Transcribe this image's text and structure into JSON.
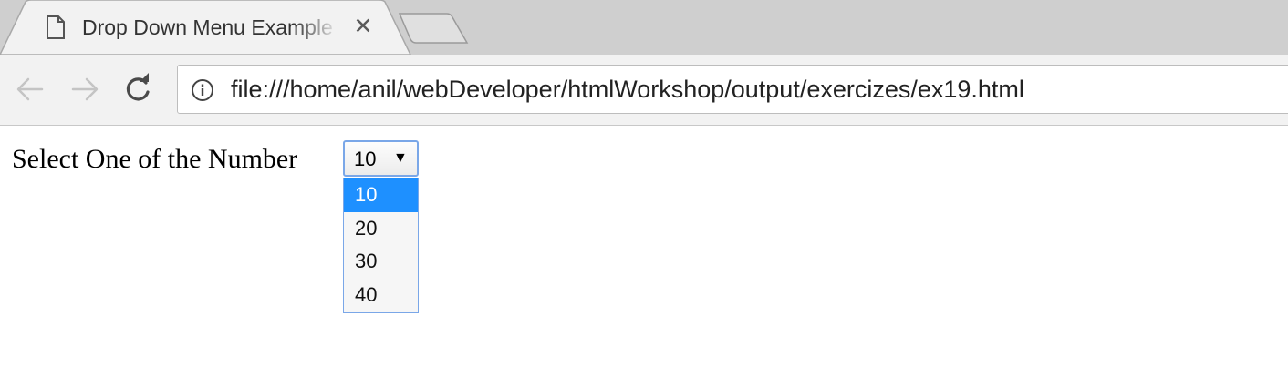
{
  "browser": {
    "tab": {
      "title": "Drop Down Menu Example",
      "icon": "document-icon",
      "close_glyph": "✕"
    },
    "new_tab_icon": "new-tab-icon",
    "toolbar": {
      "back_icon": "back-arrow-icon",
      "forward_icon": "forward-arrow-icon",
      "reload_icon": "reload-icon",
      "info_icon": "info-icon",
      "url": "file:///home/anil/webDeveloper/htmlWorkshop/output/exercizes/ex19.html"
    }
  },
  "page": {
    "label": "Select One of the Number",
    "select": {
      "value": "10",
      "arrow": "▼",
      "options": [
        "10",
        "20",
        "30",
        "40"
      ],
      "highlighted_option": "10"
    }
  },
  "colors": {
    "tabstrip": "#cfcfcf",
    "toolbar": "#f2f2f2",
    "highlight": "#1e90ff",
    "focus_border": "#7aa7e8"
  }
}
